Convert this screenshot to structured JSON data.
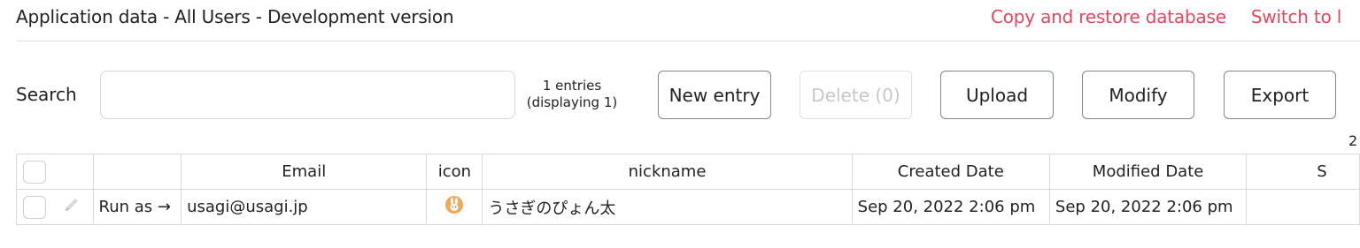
{
  "header": {
    "title": "Application data - All Users - Development version",
    "links": [
      "Copy and restore database",
      "Switch to l"
    ]
  },
  "search": {
    "label": "Search",
    "value": "",
    "placeholder": ""
  },
  "entries": {
    "count_text": "1 entries",
    "display_text": "(displaying 1)"
  },
  "toolbar": {
    "new_label": "New entry",
    "delete_label": "Delete (0)",
    "upload_label": "Upload",
    "modify_label": "Modify",
    "export_label": "Export"
  },
  "pagination": {
    "page_text": "2"
  },
  "table": {
    "columns": [
      "",
      "",
      "Email",
      "icon",
      "nickname",
      "Created Date",
      "Modified Date",
      "S"
    ],
    "rows": [
      {
        "run_as": "Run as →",
        "email": "usagi@usagi.jp",
        "icon": "rabbit-avatar-icon",
        "nickname": "うさぎのぴょん太",
        "created": "Sep 20, 2022 2:06 pm",
        "modified": "Sep 20, 2022 2:06 pm",
        "extra": ""
      }
    ]
  },
  "colors": {
    "accent_link": "#e8455d",
    "border": "#d9d9d9",
    "avatar": "#f0a85a"
  }
}
